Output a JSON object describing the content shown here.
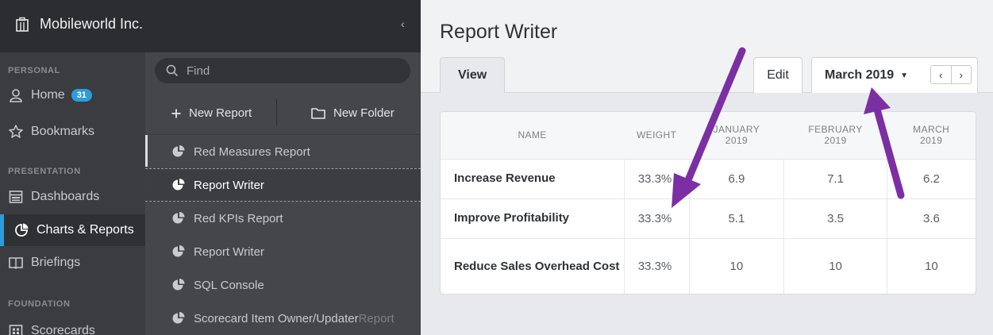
{
  "org": {
    "name": "Mobileworld Inc.",
    "collapse_glyph": "‹"
  },
  "sidebar": {
    "sections": [
      "PERSONAL",
      "PRESENTATION",
      "FOUNDATION"
    ],
    "items": [
      {
        "label": "Home",
        "badge": "31",
        "icon": "user-icon"
      },
      {
        "label": "Bookmarks",
        "icon": "star-icon"
      },
      {
        "label": "Dashboards",
        "icon": "dashboard-icon"
      },
      {
        "label": "Charts & Reports",
        "icon": "pie-chart-icon"
      },
      {
        "label": "Briefings",
        "icon": "book-icon"
      },
      {
        "label": "Scorecards",
        "icon": "grid-icon"
      }
    ]
  },
  "reports_panel": {
    "search_placeholder": "Find",
    "new_report": "New Report",
    "new_folder": "New Folder",
    "items": [
      {
        "label": "Red Measures Report"
      },
      {
        "label": "Report Writer"
      },
      {
        "label": "Red KPIs Report"
      },
      {
        "label": "Report Writer"
      },
      {
        "label": "SQL Console"
      },
      {
        "label": "Scorecard Item Owner/Updater Report",
        "visible_part": "Scorecard Item Owner/Updater ",
        "faded_part": "Report"
      }
    ]
  },
  "main": {
    "title": "Report Writer",
    "tabs": {
      "view": "View",
      "edit": "Edit"
    },
    "period": "March 2019",
    "pager": {
      "prev": "‹",
      "next": "›"
    }
  },
  "table": {
    "columns": [
      {
        "line1": "NAME",
        "line2": ""
      },
      {
        "line1": "WEIGHT",
        "line2": ""
      },
      {
        "line1": "JANUARY",
        "line2": "2019"
      },
      {
        "line1": "FEBRUARY",
        "line2": "2019"
      },
      {
        "line1": "MARCH",
        "line2": "2019"
      }
    ],
    "rows": [
      {
        "name": "Increase Revenue",
        "weight": "33.3%",
        "jan": "6.9",
        "feb": "7.1",
        "mar": "6.2"
      },
      {
        "name": "Improve Profitability",
        "weight": "33.3%",
        "jan": "5.1",
        "feb": "3.5",
        "mar": "3.6"
      },
      {
        "name": "Reduce Sales Overhead Cost",
        "weight": "33.3%",
        "jan": "10",
        "feb": "10",
        "mar": "10"
      }
    ]
  },
  "colors": {
    "accent": "#2d9cdb",
    "annotation_arrow": "#7b2fa3"
  }
}
